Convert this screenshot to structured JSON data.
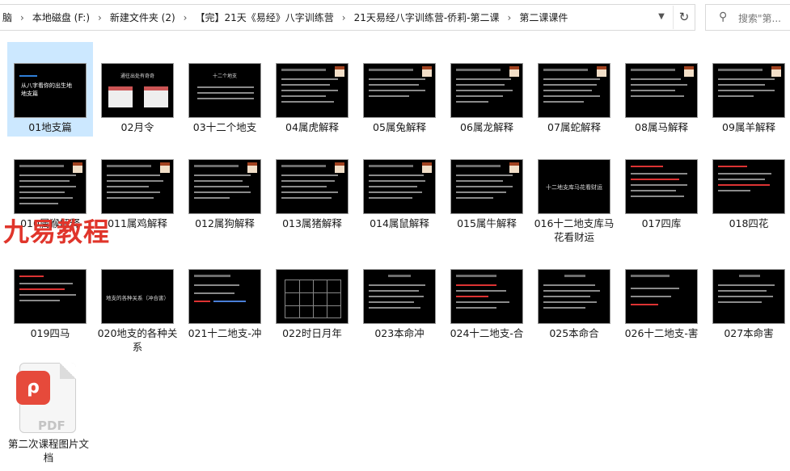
{
  "address_bar": {
    "crumbs": [
      "脑",
      "本地磁盘 (F:)",
      "新建文件夹 (2)",
      "【完】21天《易经》八字训练营",
      "21天易经八字训练营-侨莉-第二课",
      "第二课课件"
    ],
    "separator": "›",
    "dropdown_icon": "chevron-down-icon",
    "refresh_icon": "refresh-icon"
  },
  "search": {
    "placeholder": "搜索\"第...",
    "icon": "search-icon"
  },
  "files": [
    {
      "name": "01地支篇",
      "selected": true
    },
    {
      "name": "02月令"
    },
    {
      "name": "03十二个地支"
    },
    {
      "name": "04属虎解释"
    },
    {
      "name": "05属兔解释"
    },
    {
      "name": "06属龙解释"
    },
    {
      "name": "07属蛇解释"
    },
    {
      "name": "08属马解释"
    },
    {
      "name": "09属羊解释"
    },
    {
      "name": "010属猴解释"
    },
    {
      "name": "011属鸡解释"
    },
    {
      "name": "012属狗解释"
    },
    {
      "name": "013属猪解释"
    },
    {
      "name": "014属鼠解释"
    },
    {
      "name": "015属牛解释"
    },
    {
      "name": "016十二地支库马花看财运"
    },
    {
      "name": "017四库"
    },
    {
      "name": "018四花"
    },
    {
      "name": "019四马"
    },
    {
      "name": "020地支的各种关系"
    },
    {
      "name": "021十二地支-冲"
    },
    {
      "name": "022时日月年"
    },
    {
      "name": "023本命冲"
    },
    {
      "name": "024十二地支-合"
    },
    {
      "name": "025本命合"
    },
    {
      "name": "026十二地支-害"
    },
    {
      "name": "027本命害"
    }
  ],
  "thumb_texts": {
    "t01": "从八字看你的出生地\n地支篇",
    "t02": "通往出处有奇奇",
    "t03": "十二个地支",
    "t16": "十二地支库马花看财运",
    "t20": "地支的各种关系（冲合害）"
  },
  "pdf": {
    "name": "第二次课程图片文档",
    "badge": "ρ",
    "type_text": "PDF"
  },
  "watermark": "九易教程",
  "colors": {
    "selection": "#cce8ff",
    "watermark": "#e0352b",
    "pdf_badge": "#e64a3b"
  }
}
